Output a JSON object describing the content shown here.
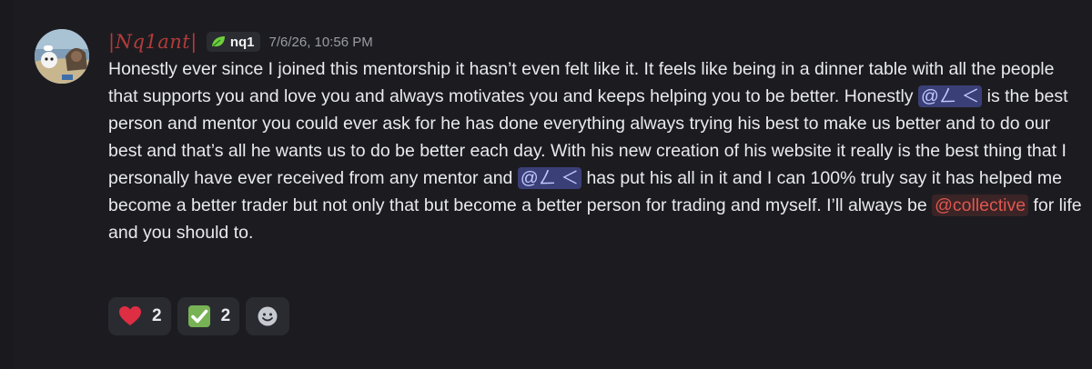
{
  "message": {
    "author": {
      "name": "|Nq1ant|",
      "tag_icon": "leaf-icon",
      "tag_label": "nq1"
    },
    "timestamp": "7/6/26, 10:56 PM",
    "content": {
      "seg1": "Honestly ever since I joined this mentorship it hasn’t even felt like it. It feels like being in a dinner table with all the people that supports you and love you and always motivates you and keeps helping you to be better. Honestly ",
      "mention1": "@ㄥ ＜",
      "seg2": " is the best person and mentor you could ever ask for he has done everything always trying his best to make us better and to do our best and that’s all he wants us to do be better each day. With his new creation of his website it really is the best thing that I personally have ever received from any mentor and ",
      "mention2": "@ㄥ ＜",
      "seg3": " has put his all in it and I can 100% truly say it has helped me become a better trader but not only that but become a better person for trading and myself. I’ll always be ",
      "role_mention": "@collective",
      "seg4": " for life and you should to."
    },
    "reactions": [
      {
        "emoji": "heart-icon",
        "count": "2"
      },
      {
        "emoji": "check-mark-icon",
        "count": "2"
      }
    ],
    "add_reaction_icon": "smiley-add-icon"
  },
  "colors": {
    "username": "#b33b3b",
    "mention_bg": "#3b3f77",
    "mention_text": "#c3c9ff",
    "role_mention_text": "#e0574f",
    "heart": "#dd2e44",
    "check_box": "#77b255"
  }
}
